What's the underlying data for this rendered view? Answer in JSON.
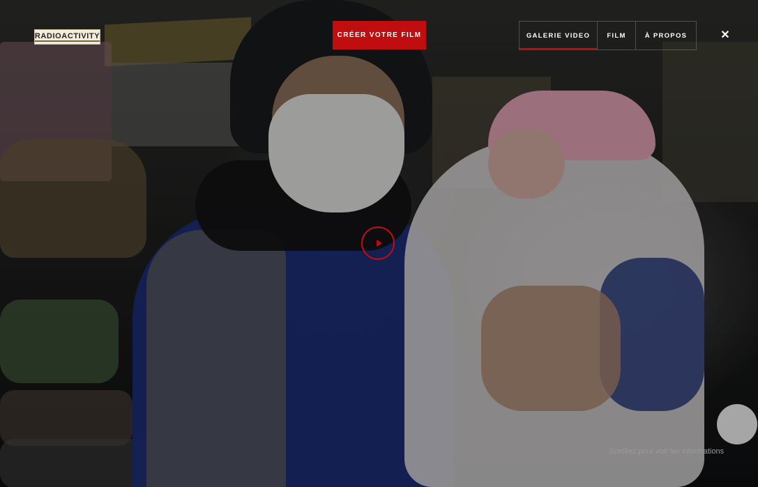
{
  "brand": {
    "logo_text": "RADIOACTIVITY"
  },
  "header": {
    "cta_label": "CRÉER VOTRE FILM",
    "nav": [
      {
        "label": "GALERIE VIDEO",
        "active": true
      },
      {
        "label": "FILM",
        "active": false
      },
      {
        "label": "À PROPOS",
        "active": false
      }
    ],
    "close_icon": "close-icon",
    "close_glyph": "✕"
  },
  "player": {
    "play_icon": "play-icon"
  },
  "footer": {
    "scroll_hint": "Scrollez pour voir les informations"
  },
  "colors": {
    "accent": "#c00d10",
    "text": "#ffffff",
    "hint": "#9a9a9a"
  }
}
